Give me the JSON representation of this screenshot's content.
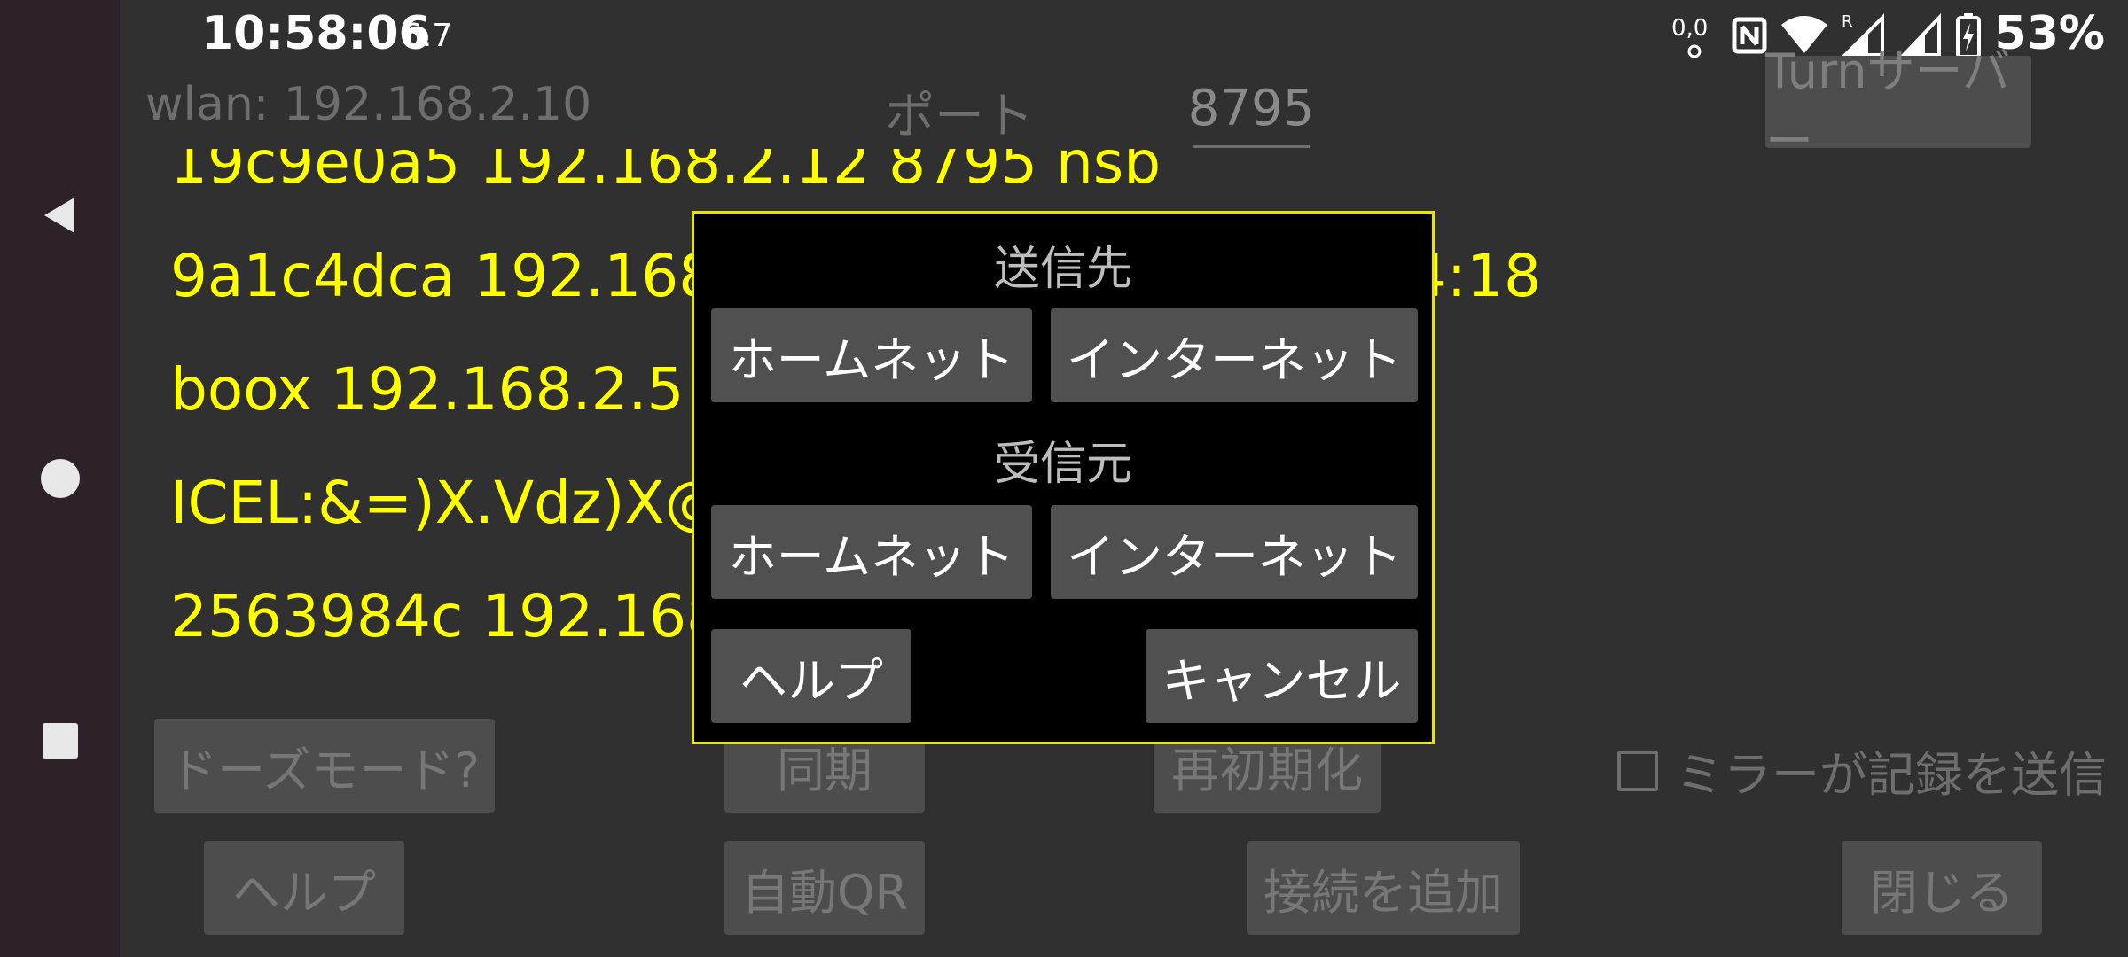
{
  "status_bar": {
    "time": "10:58:06",
    "time_suffix": "6.7",
    "battery": "53%",
    "icons": [
      "data-activity-icon",
      "nfc-icon",
      "wifi-icon",
      "signal-roaming-icon",
      "signal-icon",
      "battery-charging-icon"
    ]
  },
  "nav": {
    "icons": [
      "back-icon",
      "home-icon",
      "recents-icon"
    ]
  },
  "top": {
    "wlan": "wlan: 192.168.2.10",
    "port_label": "ポート",
    "port_value": "8795",
    "turn_button": "Turnサーバー"
  },
  "peers": [
    "19c9e0a5 192.168.2.12 8795 nsb",
    "9a1c4dca 192.168.2.2 8795 16:17:f1:0e:54:18",
    "boox 192.168.2.5 8795",
    "ICEL:&=)X.Vdz)X@ 192.168.2.4 8795 87",
    "2563984c 192.168.2.7 8795"
  ],
  "buttons": {
    "doze": "ドーズモード?",
    "sync": "同期",
    "reinit": "再初期化",
    "help": "ヘルプ",
    "auto_qr": "自動QR",
    "add_connection": "接続を追加",
    "close": "閉じる"
  },
  "mirror_checkbox": {
    "label": "ミラーが記録を送信",
    "checked": false
  },
  "dialog": {
    "send_title": "送信先",
    "send_home": "ホームネット",
    "send_internet": "インターネット",
    "recv_title": "受信元",
    "recv_home": "ホームネット",
    "recv_internet": "インターネット",
    "help": "ヘルプ",
    "cancel": "キャンセル"
  },
  "colors": {
    "background": "#303030",
    "peer_text": "#ffff00",
    "dialog_border": "#e6e600",
    "button": "#4d4d4d",
    "navbar": "#2d2227"
  }
}
